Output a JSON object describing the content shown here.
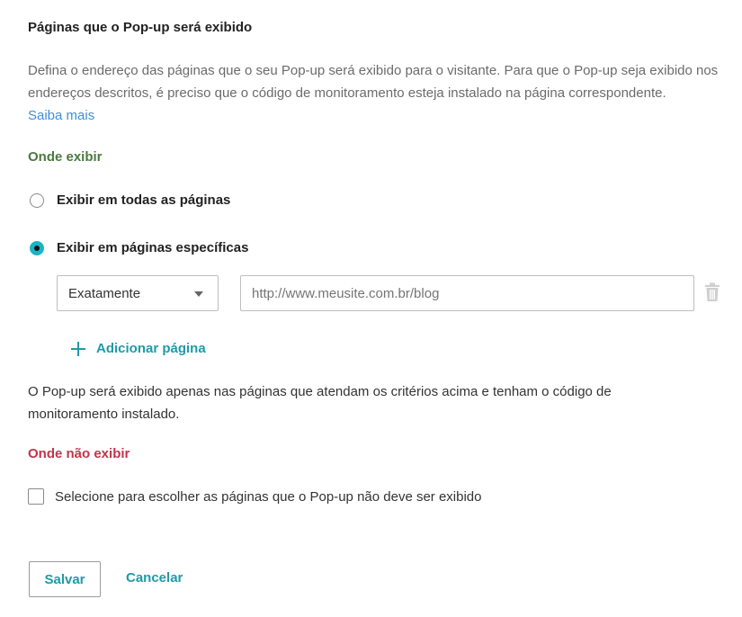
{
  "header": {
    "title": "Páginas que o Pop-up será exibido",
    "description": "Defina o endereço das páginas que o seu Pop-up será exibido para o visitante. Para que o Pop-up seja exibido nos endereços descritos, é preciso que o código de monitoramento esteja instalado na página correspondente.",
    "learn_more": "Saiba mais"
  },
  "show_section": {
    "label": "Onde exibir",
    "color": "#4a7a3e",
    "options": [
      {
        "label": "Exibir em todas as páginas",
        "checked": false
      },
      {
        "label": "Exibir em páginas específicas",
        "checked": true
      }
    ],
    "rule": {
      "match_type": "Exatamente",
      "url_value": "",
      "url_placeholder": "http://www.meusite.com.br/blog"
    },
    "add_page": "Adicionar página",
    "note": "O Pop-up será exibido apenas nas páginas que atendam os critérios acima e tenham o código de monitoramento instalado."
  },
  "hide_section": {
    "label": "Onde não exibir",
    "color": "#c5334b",
    "checkbox_label": "Selecione para escolher as páginas que o Pop-up não deve ser exibido",
    "checked": false
  },
  "actions": {
    "save": "Salvar",
    "cancel": "Cancelar"
  },
  "colors": {
    "accent": "#1f9aa8",
    "radio_selected": "#1bb3c6",
    "link": "#3f8fd6"
  },
  "icons": {
    "dropdown": "caret-down-icon",
    "delete": "trash-icon",
    "add": "plus-icon"
  }
}
